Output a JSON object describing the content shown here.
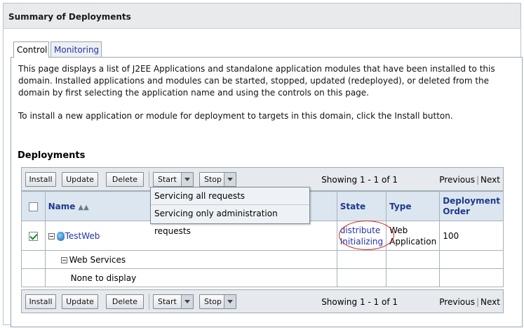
{
  "header": {
    "title": "Summary of Deployments"
  },
  "tabs": [
    {
      "label": "Control"
    },
    {
      "label": "Monitoring"
    }
  ],
  "description": "This page displays a list of J2EE Applications and standalone application modules that have been installed to this domain. Installed applications and modules can be started, stopped, updated (redeployed), or deleted from the domain by first selecting the application name and using the controls on this page.",
  "install_hint": "To install a new application or module for deployment to targets in this domain, click the Install button.",
  "deployments_title": "Deployments",
  "toolbar": {
    "install": "Install",
    "update": "Update",
    "delete": "Delete",
    "start": "Start",
    "stop": "Stop",
    "showing": "Showing 1 - 1 of 1",
    "previous": "Previous",
    "next": "Next"
  },
  "start_menu": {
    "items": [
      "Servicing all requests",
      "Servicing only administration requests"
    ]
  },
  "table": {
    "headers": {
      "name": "Name",
      "state": "State",
      "type": "Type",
      "order": "Deployment Order"
    },
    "rows": [
      {
        "name": "TestWeb",
        "state_line1": "distribute",
        "state_line2": "Initializing",
        "type": "Web Application",
        "order": "100",
        "checked": true
      }
    ],
    "web_services": "Web Services",
    "none": "None to display"
  },
  "colors": {
    "link": "#2233aa",
    "header_bg": "#dce6f0",
    "highlight_oval": "#d02020"
  }
}
